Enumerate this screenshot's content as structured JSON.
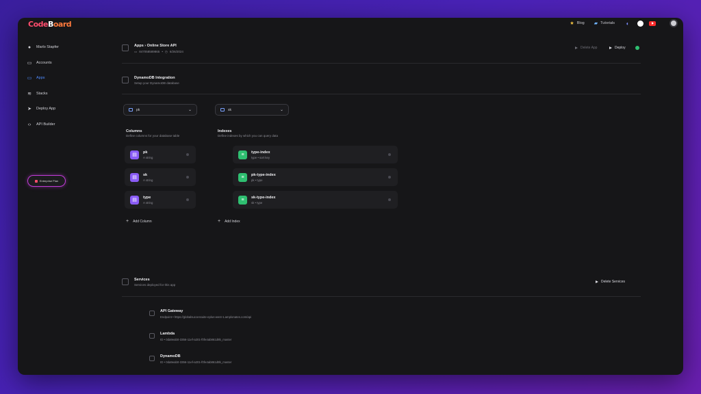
{
  "app": {
    "logo": [
      "Code",
      "B",
      "oard"
    ]
  },
  "topnav": {
    "blog_label": "Blog",
    "tutorials_label": "Tutorials",
    "icons": [
      "star-icon",
      "book-icon",
      "discord-icon",
      "github-icon",
      "youtube-icon",
      "user-icon"
    ]
  },
  "sidebar": {
    "items": [
      {
        "label": "Marlo Stapfer",
        "icon": "user-circle-icon",
        "active": false
      },
      {
        "label": "Accounts",
        "icon": "accounts-icon",
        "active": false
      },
      {
        "label": "Apps",
        "icon": "apps-icon",
        "active": true
      },
      {
        "label": "Stacks",
        "icon": "stacks-icon",
        "active": false
      },
      {
        "label": "Deploy App",
        "icon": "rocket-icon",
        "active": false
      },
      {
        "label": "API Builder",
        "icon": "code-icon",
        "active": false
      }
    ],
    "enterprise_label": "Enterprise Plan"
  },
  "header": {
    "breadcrumb": "Apps › Online Store API",
    "app_id": "847058589865",
    "date": "6/26/2024",
    "delete_label": "Delete App",
    "deploy_label": "Deploy"
  },
  "dynamo": {
    "title": "DynamoDB Integration",
    "subtitle": "Setup your DynamoDB database",
    "partition_key": "pk",
    "sort_key": "sk",
    "columns_title": "Columns",
    "columns_subtitle": "Define columns for your database table",
    "indexes_title": "Indexes",
    "indexes_subtitle": "Define indexes by which you can query data",
    "columns": [
      {
        "name": "pk",
        "type": "string"
      },
      {
        "name": "sk",
        "type": "string"
      },
      {
        "name": "type",
        "type": "string"
      }
    ],
    "indexes": [
      {
        "name": "type-index",
        "meta": "type • sort key"
      },
      {
        "name": "pk-type-index",
        "meta": "pk • type"
      },
      {
        "name": "sk-type-index",
        "meta": "sk • type"
      }
    ],
    "add_column_label": "Add Column",
    "add_index_label": "Add Index"
  },
  "services": {
    "title": "Services",
    "subtitle": "Services deployed for this app",
    "delete_label": "Delete Services",
    "items": [
      {
        "name": "API Gateway",
        "meta": "Endpoint • https://globalsuccessuite-eplus-west-1.amplonates.com/api"
      },
      {
        "name": "Lambda",
        "meta": "ID • 0da9eab0-3356-11ef-a201-f0fe4ab861d9b_master"
      },
      {
        "name": "DynamoDB",
        "meta": "ID • 0da9eab0-3356-11ef-a201-f0fe4ab861d9b_master"
      }
    ]
  }
}
